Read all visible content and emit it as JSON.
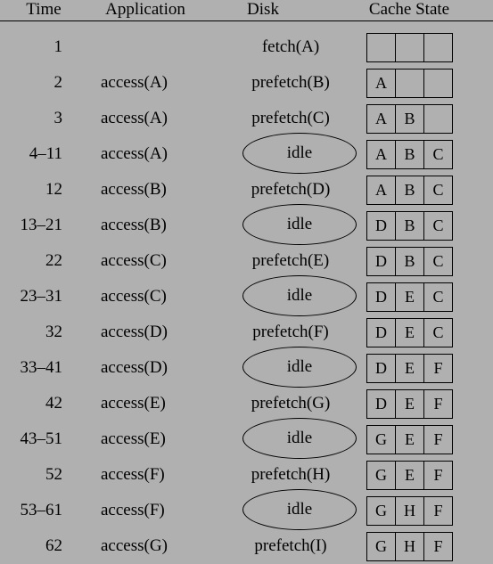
{
  "figure": {
    "background_color": "#b0b0b0",
    "text_color": "#000000"
  },
  "header": {
    "time": "Time",
    "application": "Application",
    "disk": "Disk",
    "cache_state": "Cache State"
  },
  "columns": [
    "Time",
    "Application",
    "Disk",
    "Cache State"
  ],
  "idle_label": "idle",
  "rows": [
    {
      "time": "1",
      "application": "",
      "disk": "fetch(A)",
      "disk_idle": false,
      "cache": [
        "",
        "",
        ""
      ]
    },
    {
      "time": "2",
      "application": "access(A)",
      "disk": "prefetch(B)",
      "disk_idle": false,
      "cache": [
        "A",
        "",
        ""
      ]
    },
    {
      "time": "3",
      "application": "access(A)",
      "disk": "prefetch(C)",
      "disk_idle": false,
      "cache": [
        "A",
        "B",
        ""
      ]
    },
    {
      "time": "4–11",
      "application": "access(A)",
      "disk": "idle",
      "disk_idle": true,
      "cache": [
        "A",
        "B",
        "C"
      ]
    },
    {
      "time": "12",
      "application": "access(B)",
      "disk": "prefetch(D)",
      "disk_idle": false,
      "cache": [
        "A",
        "B",
        "C"
      ]
    },
    {
      "time": "13–21",
      "application": "access(B)",
      "disk": "idle",
      "disk_idle": true,
      "cache": [
        "D",
        "B",
        "C"
      ]
    },
    {
      "time": "22",
      "application": "access(C)",
      "disk": "prefetch(E)",
      "disk_idle": false,
      "cache": [
        "D",
        "B",
        "C"
      ]
    },
    {
      "time": "23–31",
      "application": "access(C)",
      "disk": "idle",
      "disk_idle": true,
      "cache": [
        "D",
        "E",
        "C"
      ]
    },
    {
      "time": "32",
      "application": "access(D)",
      "disk": "prefetch(F)",
      "disk_idle": false,
      "cache": [
        "D",
        "E",
        "C"
      ]
    },
    {
      "time": "33–41",
      "application": "access(D)",
      "disk": "idle",
      "disk_idle": true,
      "cache": [
        "D",
        "E",
        "F"
      ]
    },
    {
      "time": "42",
      "application": "access(E)",
      "disk": "prefetch(G)",
      "disk_idle": false,
      "cache": [
        "D",
        "E",
        "F"
      ]
    },
    {
      "time": "43–51",
      "application": "access(E)",
      "disk": "idle",
      "disk_idle": true,
      "cache": [
        "G",
        "E",
        "F"
      ]
    },
    {
      "time": "52",
      "application": "access(F)",
      "disk": "prefetch(H)",
      "disk_idle": false,
      "cache": [
        "G",
        "E",
        "F"
      ]
    },
    {
      "time": "53–61",
      "application": "access(F)",
      "disk": "idle",
      "disk_idle": true,
      "cache": [
        "G",
        "H",
        "F"
      ]
    },
    {
      "time": "62",
      "application": "access(G)",
      "disk": "prefetch(I)",
      "disk_idle": false,
      "cache": [
        "G",
        "H",
        "F"
      ]
    }
  ]
}
